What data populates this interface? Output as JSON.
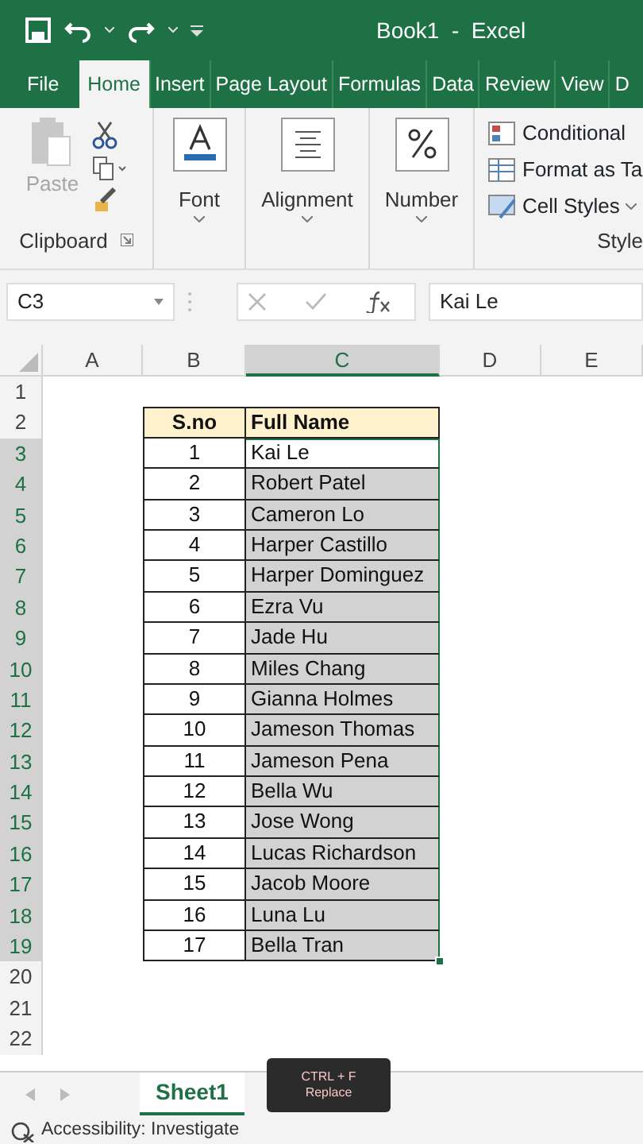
{
  "title_bar": {
    "title": "Book1  -  Excel"
  },
  "ribbon_tabs": [
    {
      "label": "File",
      "selected": false
    },
    {
      "label": "Home",
      "selected": true
    },
    {
      "label": "Insert",
      "selected": false
    },
    {
      "label": "Page Layout",
      "selected": false
    },
    {
      "label": "Formulas",
      "selected": false
    },
    {
      "label": "Data",
      "selected": false
    },
    {
      "label": "Review",
      "selected": false
    },
    {
      "label": "View",
      "selected": false
    },
    {
      "label": "D",
      "selected": false
    }
  ],
  "ribbon": {
    "clipboard": {
      "paste": {
        "label": "Paste",
        "disabled": true
      },
      "label": "Clipboard"
    },
    "groups": [
      {
        "kind": "font",
        "label": "Font"
      },
      {
        "kind": "alignment",
        "label": "Alignment"
      },
      {
        "kind": "number",
        "label": "Number"
      }
    ],
    "styles": {
      "items": [
        {
          "kind": "conditional",
          "label": "Conditional"
        },
        {
          "kind": "table",
          "label": "Format as Ta"
        },
        {
          "kind": "cell",
          "label": "Cell Styles"
        }
      ],
      "label": "Style"
    }
  },
  "formula_bar": {
    "name_box": "C3",
    "value": "Kai Le"
  },
  "sheet": {
    "columns": [
      {
        "label": "A",
        "selected": false
      },
      {
        "label": "B",
        "selected": false
      },
      {
        "label": "C",
        "selected": true
      },
      {
        "label": "D",
        "selected": false
      },
      {
        "label": "E",
        "selected": false
      }
    ],
    "row_numbers": [
      {
        "label": "1",
        "selected": false
      },
      {
        "label": "2",
        "selected": false
      },
      {
        "label": "3",
        "selected": true
      },
      {
        "label": "4",
        "selected": true
      },
      {
        "label": "5",
        "selected": true
      },
      {
        "label": "6",
        "selected": true
      },
      {
        "label": "7",
        "selected": true
      },
      {
        "label": "8",
        "selected": true
      },
      {
        "label": "9",
        "selected": true
      },
      {
        "label": "10",
        "selected": true
      },
      {
        "label": "11",
        "selected": true
      },
      {
        "label": "12",
        "selected": true
      },
      {
        "label": "13",
        "selected": true
      },
      {
        "label": "14",
        "selected": true
      },
      {
        "label": "15",
        "selected": true
      },
      {
        "label": "16",
        "selected": true
      },
      {
        "label": "17",
        "selected": true
      },
      {
        "label": "18",
        "selected": true
      },
      {
        "label": "19",
        "selected": true
      },
      {
        "label": "20",
        "selected": false
      },
      {
        "label": "21",
        "selected": false
      },
      {
        "label": "22",
        "selected": false
      }
    ],
    "table": {
      "header": [
        "S.no",
        "Full Name"
      ],
      "rows": [
        {
          "sno": "1",
          "name": "Kai Le",
          "selected": true,
          "active": true
        },
        {
          "sno": "2",
          "name": "Robert Patel",
          "selected": true,
          "active": false
        },
        {
          "sno": "3",
          "name": "Cameron Lo",
          "selected": true,
          "active": false
        },
        {
          "sno": "4",
          "name": "Harper Castillo",
          "selected": true,
          "active": false
        },
        {
          "sno": "5",
          "name": "Harper Dominguez",
          "selected": true,
          "active": false
        },
        {
          "sno": "6",
          "name": "Ezra Vu",
          "selected": true,
          "active": false
        },
        {
          "sno": "7",
          "name": "Jade Hu",
          "selected": true,
          "active": false
        },
        {
          "sno": "8",
          "name": "Miles Chang",
          "selected": true,
          "active": false
        },
        {
          "sno": "9",
          "name": "Gianna Holmes",
          "selected": true,
          "active": false
        },
        {
          "sno": "10",
          "name": "Jameson Thomas",
          "selected": true,
          "active": false
        },
        {
          "sno": "11",
          "name": "Jameson Pena",
          "selected": true,
          "active": false
        },
        {
          "sno": "12",
          "name": "Bella Wu",
          "selected": true,
          "active": false
        },
        {
          "sno": "13",
          "name": "Jose Wong",
          "selected": true,
          "active": false
        },
        {
          "sno": "14",
          "name": "Lucas Richardson",
          "selected": true,
          "active": false
        },
        {
          "sno": "15",
          "name": "Jacob Moore",
          "selected": true,
          "active": false
        },
        {
          "sno": "16",
          "name": "Luna Lu",
          "selected": true,
          "active": false
        },
        {
          "sno": "17",
          "name": "Bella Tran",
          "selected": true,
          "active": false
        }
      ]
    }
  },
  "sheet_tabs": [
    {
      "label": "Sheet1",
      "selected": true
    }
  ],
  "key_overlay": {
    "keys": "CTRL + F",
    "action": "Replace"
  },
  "status_bar": {
    "text": "Accessibility: Investigate"
  }
}
